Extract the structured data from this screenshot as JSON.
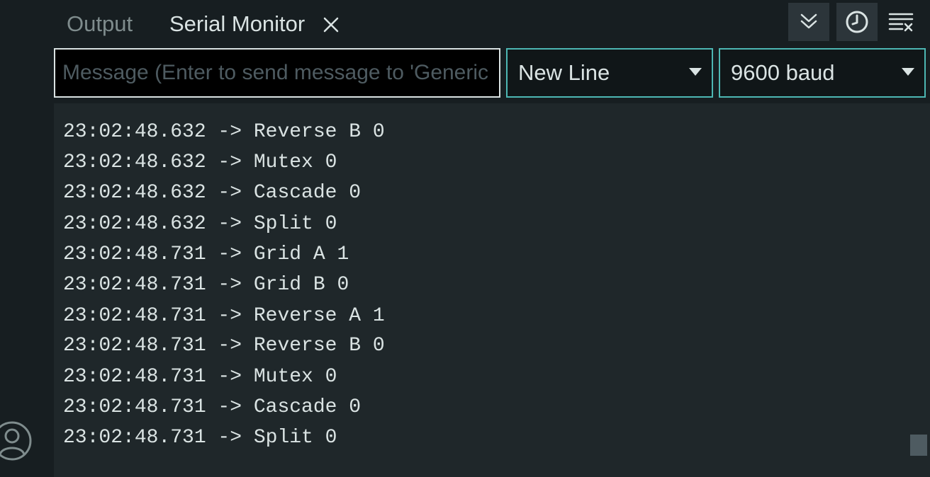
{
  "tabs": {
    "output_label": "Output",
    "serial_label": "Serial Monitor"
  },
  "icons": {
    "close": "close-icon",
    "autoscroll": "double-chevron-down-icon",
    "timestamp": "clock-icon",
    "clear": "clear-output-icon",
    "account": "account-icon",
    "dropdown": "caret-down-icon"
  },
  "message_input": {
    "value": "",
    "placeholder": "Message (Enter to send message to 'Generic"
  },
  "line_ending": {
    "selected": "New Line"
  },
  "baud_rate": {
    "selected": "9600 baud"
  },
  "log": {
    "lines": [
      "23:02:48.632 -> Reverse B 0",
      "23:02:48.632 -> Mutex 0",
      "23:02:48.632 -> Cascade 0",
      "23:02:48.632 -> Split 0",
      "23:02:48.731 -> Grid A 1",
      "23:02:48.731 -> Grid B 0",
      "23:02:48.731 -> Reverse A 1",
      "23:02:48.731 -> Reverse B 0",
      "23:02:48.731 -> Mutex 0",
      "23:02:48.731 -> Cascade 0",
      "23:02:48.731 -> Split 0"
    ]
  },
  "colors": {
    "background": "#171e21",
    "log_background": "#1f272a",
    "accent": "#4db7b3",
    "text": "#dae3e3",
    "muted_text": "#7f8c8d"
  }
}
